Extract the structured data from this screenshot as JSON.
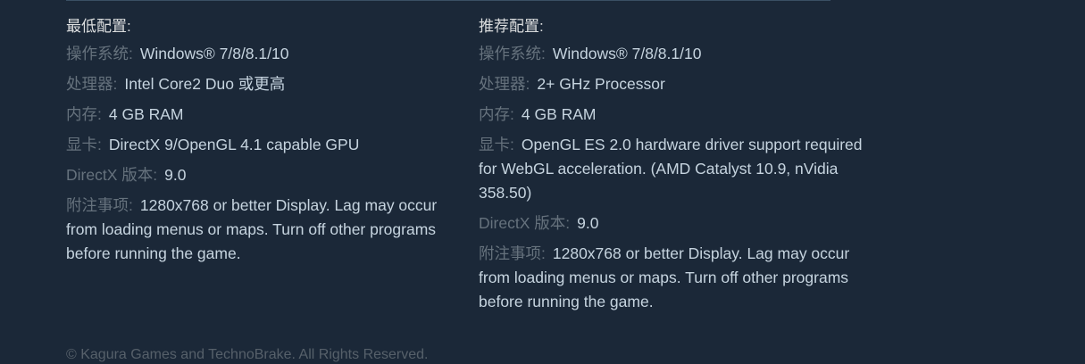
{
  "minimum": {
    "title": "最低配置:",
    "items": [
      {
        "label": "操作系统:",
        "value": "Windows® 7/8/8.1/10"
      },
      {
        "label": "处理器:",
        "value": "Intel Core2 Duo 或更高"
      },
      {
        "label": "内存:",
        "value": "4 GB RAM"
      },
      {
        "label": "显卡:",
        "value": "DirectX 9/OpenGL 4.1 capable GPU"
      },
      {
        "label": "DirectX 版本:",
        "value": "9.0"
      },
      {
        "label": "附注事项:",
        "value": "1280x768 or better Display. Lag may occur from loading menus or maps. Turn off other programs before running the game."
      }
    ]
  },
  "recommended": {
    "title": "推荐配置:",
    "items": [
      {
        "label": "操作系统:",
        "value": "Windows® 7/8/8.1/10"
      },
      {
        "label": "处理器:",
        "value": "2+ GHz Processor"
      },
      {
        "label": "内存:",
        "value": "4 GB RAM"
      },
      {
        "label": "显卡:",
        "value": "OpenGL ES 2.0 hardware driver support required for WebGL acceleration. (AMD Catalyst 10.9, nVidia 358.50)"
      },
      {
        "label": "DirectX 版本:",
        "value": "9.0"
      },
      {
        "label": "附注事项:",
        "value": "1280x768 or better Display. Lag may occur from loading menus or maps. Turn off other programs before running the game."
      }
    ]
  },
  "footer": {
    "copyright": "© Kagura Games and TechnoBrake. All Rights Reserved."
  },
  "colors": {
    "background": "#1b2838",
    "label": "#66727d",
    "value": "#c6d4df",
    "title": "#dcdedf"
  }
}
